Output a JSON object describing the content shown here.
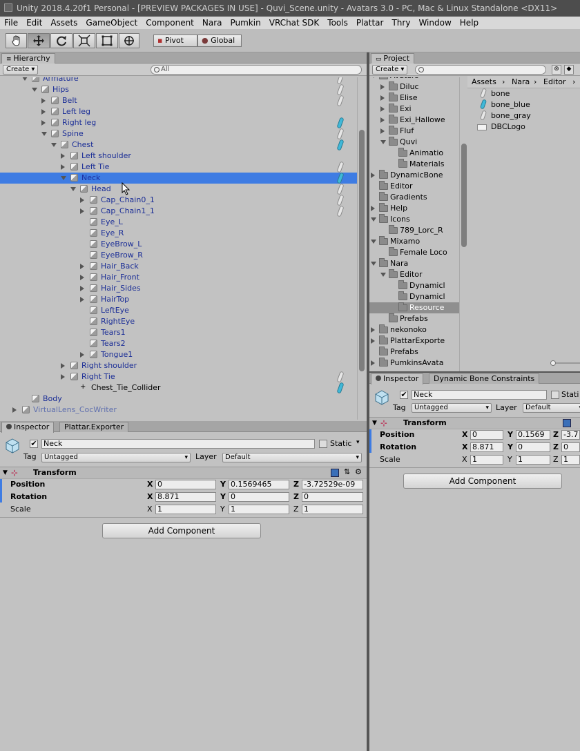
{
  "window": {
    "title": "Unity 2018.4.20f1 Personal - [PREVIEW PACKAGES IN USE] - Quvi_Scene.unity - Avatars 3.0 - PC, Mac & Linux Standalone <DX11>"
  },
  "menu": [
    "File",
    "Edit",
    "Assets",
    "GameObject",
    "Component",
    "Nara",
    "Pumkin",
    "VRChat SDK",
    "Tools",
    "Plattar",
    "Thry",
    "Window",
    "Help"
  ],
  "toolbar": {
    "pivot": "Pivot",
    "global": "Global"
  },
  "hierarchy": {
    "tab": "Hierarchy",
    "create": "Create",
    "search_placeholder": "All",
    "rows": [
      {
        "label": "Armature",
        "depth": 0,
        "arrow": "open"
      },
      {
        "label": "Hips",
        "depth": 1,
        "arrow": "open"
      },
      {
        "label": "Belt",
        "depth": 2,
        "arrow": "closed"
      },
      {
        "label": "Left leg",
        "depth": 2,
        "arrow": "closed"
      },
      {
        "label": "Right leg",
        "depth": 2,
        "arrow": "closed"
      },
      {
        "label": "Spine",
        "depth": 2,
        "arrow": "open"
      },
      {
        "label": "Chest",
        "depth": 3,
        "arrow": "open"
      },
      {
        "label": "Left shoulder",
        "depth": 4,
        "arrow": "closed"
      },
      {
        "label": "Left Tie",
        "depth": 4,
        "arrow": "closed"
      },
      {
        "label": "Neck",
        "depth": 4,
        "arrow": "open",
        "selected": true
      },
      {
        "label": "Head",
        "depth": 5,
        "arrow": "open"
      },
      {
        "label": "Cap_Chain0_1",
        "depth": 6,
        "arrow": "closed"
      },
      {
        "label": "Cap_Chain1_1",
        "depth": 6,
        "arrow": "closed"
      },
      {
        "label": "Eye_L",
        "depth": 6,
        "arrow": "none"
      },
      {
        "label": "Eye_R",
        "depth": 6,
        "arrow": "none"
      },
      {
        "label": "EyeBrow_L",
        "depth": 6,
        "arrow": "none"
      },
      {
        "label": "EyeBrow_R",
        "depth": 6,
        "arrow": "none"
      },
      {
        "label": "Hair_Back",
        "depth": 6,
        "arrow": "closed"
      },
      {
        "label": "Hair_Front",
        "depth": 6,
        "arrow": "closed"
      },
      {
        "label": "Hair_Sides",
        "depth": 6,
        "arrow": "closed"
      },
      {
        "label": "HairTop",
        "depth": 6,
        "arrow": "closed"
      },
      {
        "label": "LeftEye",
        "depth": 6,
        "arrow": "none"
      },
      {
        "label": "RightEye",
        "depth": 6,
        "arrow": "none"
      },
      {
        "label": "Tears1",
        "depth": 6,
        "arrow": "none"
      },
      {
        "label": "Tears2",
        "depth": 6,
        "arrow": "none"
      },
      {
        "label": "Tongue1",
        "depth": 6,
        "arrow": "closed"
      },
      {
        "label": "Right shoulder",
        "depth": 4,
        "arrow": "closed"
      },
      {
        "label": "Right Tie",
        "depth": 4,
        "arrow": "closed"
      },
      {
        "label": "Chest_Tie_Collider",
        "depth": 5,
        "arrow": "none",
        "black": true
      },
      {
        "label": "Body",
        "depth": 0,
        "arrow": "none"
      },
      {
        "label": "VirtualLens_CocWriter",
        "depth": -1,
        "arrow": "closed",
        "faint": true
      }
    ]
  },
  "project": {
    "tab": "Project",
    "create": "Create",
    "breadcrumb": [
      "Assets",
      "Nara",
      "Editor"
    ],
    "folders": [
      {
        "label": "Avatars",
        "depth": 0,
        "arrow": "open"
      },
      {
        "label": "Diluc",
        "depth": 1,
        "arrow": "closed"
      },
      {
        "label": "Elise",
        "depth": 1,
        "arrow": "closed"
      },
      {
        "label": "Exi",
        "depth": 1,
        "arrow": "closed"
      },
      {
        "label": "Exi_Hallowe",
        "depth": 1,
        "arrow": "closed"
      },
      {
        "label": "Fluf",
        "depth": 1,
        "arrow": "closed"
      },
      {
        "label": "Quvi",
        "depth": 1,
        "arrow": "open"
      },
      {
        "label": "Animatio",
        "depth": 2,
        "arrow": "none"
      },
      {
        "label": "Materials",
        "depth": 2,
        "arrow": "none"
      },
      {
        "label": "DynamicBone",
        "depth": 0,
        "arrow": "closed"
      },
      {
        "label": "Editor",
        "depth": 0,
        "arrow": "none"
      },
      {
        "label": "Gradients",
        "depth": 0,
        "arrow": "none"
      },
      {
        "label": "Help",
        "depth": 0,
        "arrow": "closed"
      },
      {
        "label": "Icons",
        "depth": 0,
        "arrow": "open"
      },
      {
        "label": "789_Lorc_R",
        "depth": 1,
        "arrow": "none"
      },
      {
        "label": "Mixamo",
        "depth": 0,
        "arrow": "open"
      },
      {
        "label": "Female Loco",
        "depth": 1,
        "arrow": "none"
      },
      {
        "label": "Nara",
        "depth": 0,
        "arrow": "open"
      },
      {
        "label": "Editor",
        "depth": 1,
        "arrow": "open"
      },
      {
        "label": "Dynamicl",
        "depth": 2,
        "arrow": "none"
      },
      {
        "label": "Dynamicl",
        "depth": 2,
        "arrow": "none"
      },
      {
        "label": "Resource",
        "depth": 2,
        "arrow": "none",
        "selected": true
      },
      {
        "label": "Prefabs",
        "depth": 1,
        "arrow": "none"
      },
      {
        "label": "nekonoko",
        "depth": 0,
        "arrow": "closed"
      },
      {
        "label": "PlattarExporte",
        "depth": 0,
        "arrow": "closed"
      },
      {
        "label": "Prefabs",
        "depth": 0,
        "arrow": "none"
      },
      {
        "label": "PumkinsAvata",
        "depth": 0,
        "arrow": "closed"
      }
    ],
    "files": [
      {
        "label": "bone",
        "icon": "bone-white"
      },
      {
        "label": "bone_blue",
        "icon": "bone-blue"
      },
      {
        "label": "bone_gray",
        "icon": "bone-gray"
      },
      {
        "label": "DBCLogo",
        "icon": "image"
      }
    ]
  },
  "inspector_left": {
    "tabs": [
      "Inspector",
      "Plattar.Exporter"
    ],
    "name": "Neck",
    "static_label": "Static",
    "tag_label": "Tag",
    "tag_value": "Untagged",
    "layer_label": "Layer",
    "layer_value": "Default",
    "component": "Transform",
    "position_label": "Position",
    "rotation_label": "Rotation",
    "scale_label": "Scale",
    "position": {
      "x": "0",
      "y": "0.1569465",
      "z": "-3.72529e-09"
    },
    "rotation": {
      "x": "8.871",
      "y": "0",
      "z": "0"
    },
    "scale": {
      "x": "1",
      "y": "1",
      "z": "1"
    },
    "add_component": "Add Component"
  },
  "inspector_right": {
    "tabs": [
      "Inspector",
      "Dynamic Bone Constraints"
    ],
    "name": "Neck",
    "static_label": "Stati",
    "tag_label": "Tag",
    "tag_value": "Untagged",
    "layer_label": "Layer",
    "layer_value": "Default",
    "component": "Transform",
    "position_label": "Position",
    "rotation_label": "Rotation",
    "scale_label": "Scale",
    "position": {
      "x": "0",
      "y": "0.1569",
      "z": "-3.7"
    },
    "rotation": {
      "x": "8.871",
      "y": "0",
      "z": "0"
    },
    "scale": {
      "x": "1",
      "y": "1",
      "z": "1"
    },
    "add_component": "Add Component"
  },
  "axes": {
    "x": "X",
    "y": "Y",
    "z": "Z"
  }
}
